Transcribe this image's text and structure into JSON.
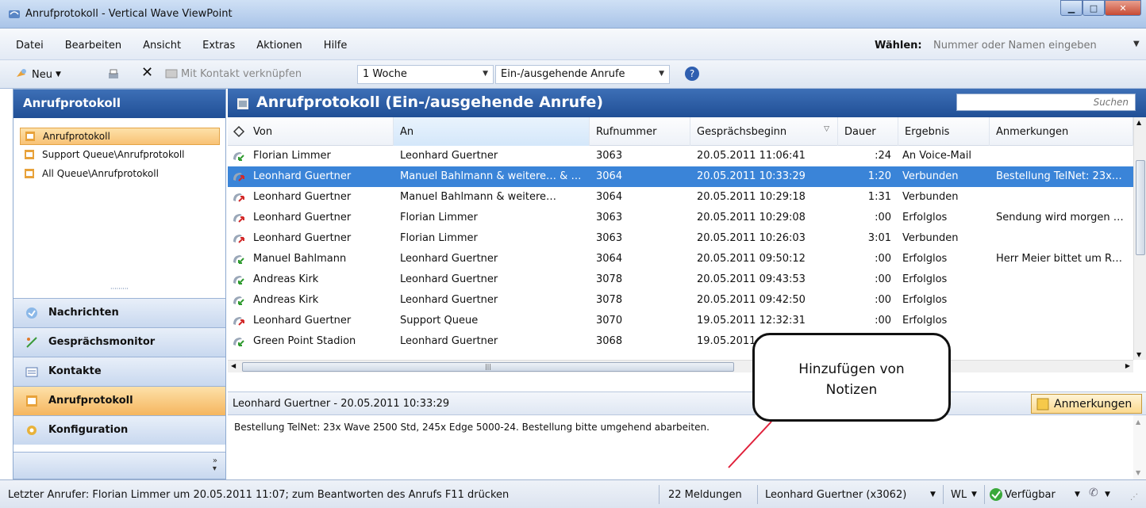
{
  "window": {
    "title": "Anrufprotokoll - Vertical Wave ViewPoint"
  },
  "menu": [
    "Datei",
    "Bearbeiten",
    "Ansicht",
    "Extras",
    "Aktionen",
    "Hilfe"
  ],
  "picker": {
    "label": "Wählen:",
    "placeholder": "Nummer oder Namen eingeben"
  },
  "toolbar": {
    "new_label": "Neu",
    "link_contact_label": "Mit Kontakt verknüpfen",
    "period_value": "1 Woche",
    "direction_value": "Ein-/ausgehende Anrufe"
  },
  "left": {
    "title": "Anrufprotokoll",
    "tree": [
      "Anrufprotokoll",
      "Support Queue\\Anrufprotokoll",
      "All Queue\\Anrufprotokoll"
    ],
    "nav": [
      "Nachrichten",
      "Gesprächsmonitor",
      "Kontakte",
      "Anrufprotokoll",
      "Konfiguration"
    ],
    "active_nav": "Anrufprotokoll"
  },
  "main": {
    "title": "Anrufprotokoll (Ein-/ausgehende Anrufe)",
    "search_placeholder": "Suchen",
    "columns": [
      "Von",
      "An",
      "Rufnummer",
      "Gesprächsbeginn",
      "Dauer",
      "Ergebnis",
      "Anmerkungen"
    ],
    "rows": [
      {
        "dir": "in",
        "von": "Florian Limmer",
        "an": "Leonhard Guertner",
        "nr": "3063",
        "beginn": "20.05.2011 11:06:41",
        "dauer": ":24",
        "ergebnis": "An Voice-Mail",
        "anm": ""
      },
      {
        "dir": "out",
        "von": "Leonhard Guertner",
        "an": "Manuel Bahlmann & weitere… & …",
        "nr": "3064",
        "beginn": "20.05.2011 10:33:29",
        "dauer": "1:20",
        "ergebnis": "Verbunden",
        "anm": "Bestellung TelNet: 23x…"
      },
      {
        "dir": "out",
        "von": "Leonhard Guertner",
        "an": "Manuel Bahlmann & weitere…",
        "nr": "3064",
        "beginn": "20.05.2011 10:29:18",
        "dauer": "1:31",
        "ergebnis": "Verbunden",
        "anm": ""
      },
      {
        "dir": "out",
        "von": "Leonhard Guertner",
        "an": "Florian Limmer",
        "nr": "3063",
        "beginn": "20.05.2011 10:29:08",
        "dauer": ":00",
        "ergebnis": "Erfolglos",
        "anm": "Sendung wird morgen …"
      },
      {
        "dir": "out",
        "von": "Leonhard Guertner",
        "an": "Florian Limmer",
        "nr": "3063",
        "beginn": "20.05.2011 10:26:03",
        "dauer": "3:01",
        "ergebnis": "Verbunden",
        "anm": ""
      },
      {
        "dir": "in",
        "von": "Manuel Bahlmann",
        "an": "Leonhard Guertner",
        "nr": "3064",
        "beginn": "20.05.2011 09:50:12",
        "dauer": ":00",
        "ergebnis": "Erfolglos",
        "anm": "Herr Meier bittet um R…"
      },
      {
        "dir": "in",
        "von": "Andreas Kirk",
        "an": "Leonhard Guertner",
        "nr": "3078",
        "beginn": "20.05.2011 09:43:53",
        "dauer": ":00",
        "ergebnis": "Erfolglos",
        "anm": ""
      },
      {
        "dir": "in",
        "von": "Andreas Kirk",
        "an": "Leonhard Guertner",
        "nr": "3078",
        "beginn": "20.05.2011 09:42:50",
        "dauer": ":00",
        "ergebnis": "Erfolglos",
        "anm": ""
      },
      {
        "dir": "out",
        "von": "Leonhard Guertner",
        "an": "Support Queue",
        "nr": "3070",
        "beginn": "19.05.2011 12:32:31",
        "dauer": ":00",
        "ergebnis": "Erfolglos",
        "anm": ""
      },
      {
        "dir": "in",
        "von": "Green Point Stadion",
        "an": "Leonhard Guertner",
        "nr": "3068",
        "beginn": "19.05.2011",
        "dauer": "",
        "ergebnis": "",
        "anm": ""
      }
    ],
    "selected_row": 1,
    "detail_header": "Leonhard Guertner - 20.05.2011 10:33:29",
    "notes_button": "Anmerkungen",
    "notes_text": "Bestellung TelNet: 23x Wave 2500 Std, 245x Edge 5000-24. Bestellung bitte umgehend abarbeiten."
  },
  "status": {
    "message": "Letzter Anrufer: Florian Limmer um 20.05.2011 11:07; zum Beantworten des Anrufs F11 drücken",
    "count": "22 Meldungen",
    "user": "Leonhard Guertner (x3062)",
    "wl": "WL",
    "presence": "Verfügbar"
  },
  "callout": {
    "line1": "Hinzufügen von",
    "line2": "Notizen"
  },
  "colors": {
    "header_blue": "#2a5aa2",
    "selection_blue": "#3a84d8",
    "active_orange": "#f8c275",
    "callout_line": "#e0203a"
  }
}
